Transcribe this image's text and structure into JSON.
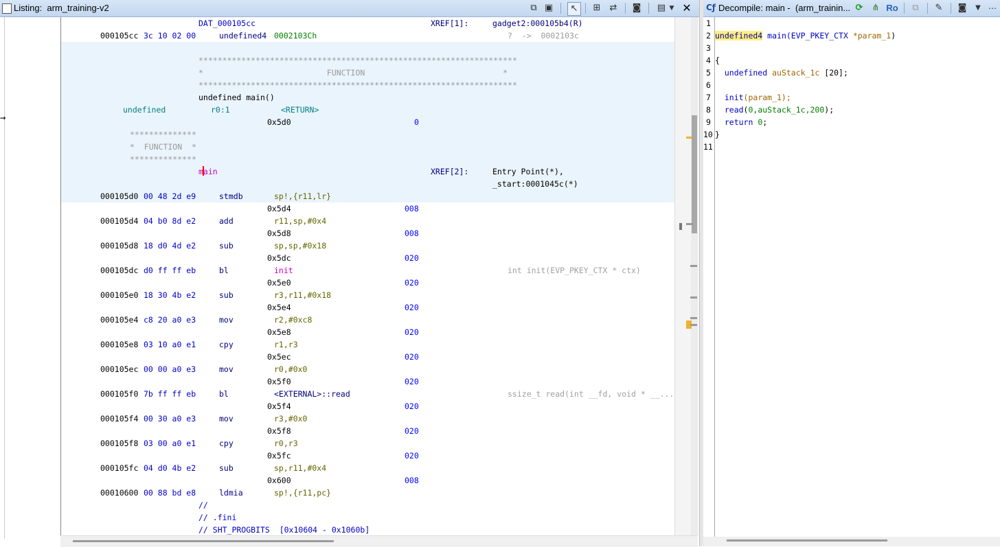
{
  "listing": {
    "title": "Listing:  arm_training-v2",
    "toolbar_icons": [
      "copy-icon",
      "paste-icon",
      "cursor-select-icon",
      "field-select-icon",
      "diff-icon",
      "snapshot-icon",
      "layout-icon",
      "menu-dropdown-icon",
      "close-icon"
    ],
    "header": {
      "dat_label": "DAT_000105cc",
      "xref1": "XREF[1]:",
      "xref1_target": "gadget2:000105b4(R)",
      "row0_addr": "000105cc",
      "row0_bytes": "3c 10 02 00",
      "row0_type": "undefined4",
      "row0_value": "0002103Ch",
      "row0_comment": "?  ->  0002103c"
    },
    "function_block": {
      "stars_line": "*******************************************************************",
      "function_line": "*                          FUNCTION                             *",
      "signature": "undefined main()",
      "ret_type": "undefined",
      "ret_storage": "r0:1",
      "ret_name": "<RETURN>",
      "stack_offset": "0x5d0",
      "stack_value": "0",
      "mini_stars": "**************",
      "mini_function": "*  FUNCTION  *",
      "label": "main",
      "xref2": "XREF[2]:",
      "xref2_a": "Entry Point(*),",
      "xref2_b": "_start:0001045c(*)"
    },
    "instructions": [
      {
        "addr": "000105d0",
        "bytes": "00 48 2d e9",
        "mnem": "stmdb",
        "operands": "sp!,{r11,lr}",
        "next": "0x5d4",
        "depth": "008",
        "comment": ""
      },
      {
        "addr": "000105d4",
        "bytes": "04 b0 8d e2",
        "mnem": "add",
        "operands": "r11,sp,#0x4",
        "next": "0x5d8",
        "depth": "008",
        "comment": ""
      },
      {
        "addr": "000105d8",
        "bytes": "18 d0 4d e2",
        "mnem": "sub",
        "operands": "sp,sp,#0x18",
        "next": "0x5dc",
        "depth": "020",
        "comment": ""
      },
      {
        "addr": "000105dc",
        "bytes": "d0 ff ff eb",
        "mnem": "bl",
        "operands": "init",
        "next": "0x5e0",
        "depth": "020",
        "comment": "int init(EVP_PKEY_CTX * ctx)"
      },
      {
        "addr": "000105e0",
        "bytes": "18 30 4b e2",
        "mnem": "sub",
        "operands": "r3,r11,#0x18",
        "next": "0x5e4",
        "depth": "020",
        "comment": ""
      },
      {
        "addr": "000105e4",
        "bytes": "c8 20 a0 e3",
        "mnem": "mov",
        "operands": "r2,#0xc8",
        "next": "0x5e8",
        "depth": "020",
        "comment": ""
      },
      {
        "addr": "000105e8",
        "bytes": "03 10 a0 e1",
        "mnem": "cpy",
        "operands": "r1,r3",
        "next": "0x5ec",
        "depth": "020",
        "comment": ""
      },
      {
        "addr": "000105ec",
        "bytes": "00 00 a0 e3",
        "mnem": "mov",
        "operands": "r0,#0x0",
        "next": "0x5f0",
        "depth": "020",
        "comment": ""
      },
      {
        "addr": "000105f0",
        "bytes": "7b ff ff eb",
        "mnem": "bl",
        "operands": "<EXTERNAL>::read",
        "next": "0x5f4",
        "depth": "020",
        "comment": "ssize_t read(int __fd, void * __..."
      },
      {
        "addr": "000105f4",
        "bytes": "00 30 a0 e3",
        "mnem": "mov",
        "operands": "r3,#0x0",
        "next": "0x5f8",
        "depth": "020",
        "comment": ""
      },
      {
        "addr": "000105f8",
        "bytes": "03 00 a0 e1",
        "mnem": "cpy",
        "operands": "r0,r3",
        "next": "0x5fc",
        "depth": "020",
        "comment": ""
      },
      {
        "addr": "000105fc",
        "bytes": "04 d0 4b e2",
        "mnem": "sub",
        "operands": "sp,r11,#0x4",
        "next": "0x600",
        "depth": "008",
        "comment": ""
      },
      {
        "addr": "00010600",
        "bytes": "00 88 bd e8",
        "mnem": "ldmia",
        "operands": "sp!,{r11,pc}",
        "next": "",
        "depth": "",
        "comment": ""
      }
    ],
    "footer": {
      "line1": "//",
      "line2": "// .fini",
      "line3": "// SHT_PROGBITS  [0x10604 - 0x1060b]"
    }
  },
  "decompile": {
    "title": "Decompile: main -  (arm_trainin...",
    "toolbar_icons": [
      "refresh-icon",
      "graph-icon",
      "ro-icon",
      "copy-icon",
      "edit-icon",
      "snapshot-icon",
      "menu-dropdown-icon"
    ],
    "ro_label": "Ro",
    "line_numbers": [
      "1",
      "2",
      "3",
      "4",
      "5",
      "6",
      "7",
      "8",
      "9",
      "10",
      "11"
    ],
    "code": {
      "l2_type": "undefined4",
      "l2_func": " main",
      "l2_rest": "(EVP_PKEY_CTX ",
      "l2_ptr": "*param_1",
      "l2_end": ")",
      "l4": "{",
      "l5_type": "  undefined",
      "l5_var": " auStack_1c ",
      "l5_arr": "[20];",
      "l7_func": "  init",
      "l7_args": "(param_1);",
      "l8_func": "  read",
      "l8_open": "(",
      "l8_args": "0,auStack_1c,200",
      "l8_close": ");",
      "l9_kw": "  return ",
      "l9_val": "0",
      "l9_end": ";",
      "l10": "}"
    }
  }
}
